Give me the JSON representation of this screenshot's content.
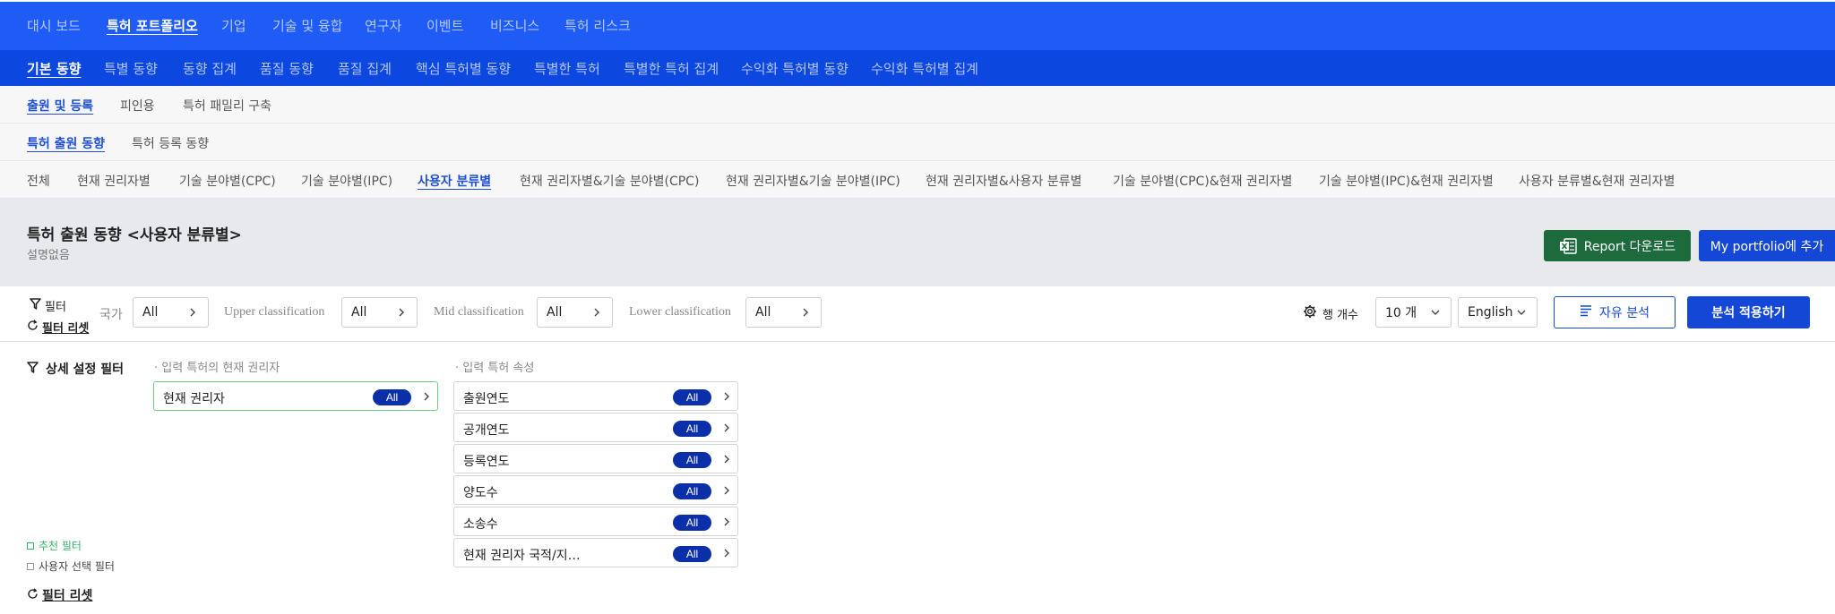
{
  "nav_main": {
    "items": [
      "대시 보드",
      "특허 포트폴리오",
      "기업",
      "기술 및 융합",
      "연구자",
      "이벤트",
      "비즈니스",
      "특허 리스크"
    ],
    "active": "특허 포트폴리오"
  },
  "nav_sub": {
    "items": [
      "기본 동향",
      "특별 동향",
      "동향 집계",
      "품질 동향",
      "품질 집계",
      "핵심 특허별 동향",
      "특별한 특허",
      "특별한 특허 집계",
      "수익화 특허별 동향",
      "수익화 특허별 집계"
    ],
    "active": "기본 동향"
  },
  "nav_level3": {
    "items": [
      "출원 및 등록",
      "피인용",
      "특허 패밀리 구축"
    ],
    "active": "출원 및 등록"
  },
  "nav_level4": {
    "items": [
      "특허 출원 동향",
      "특허 등록 동향"
    ],
    "active": "특허 출원 동향"
  },
  "nav_level5": {
    "items": [
      "전체",
      "현재 권리자별",
      "기술 분야별(CPC)",
      "기술 분야별(IPC)",
      "사용자 분류별",
      "현재 권리자별&기술 분야별(CPC)",
      "현재 권리자별&기술 분야별(IPC)",
      "현재 권리자별&사용자 분류별",
      "기술 분야별(CPC)&현재 권리자별",
      "기술 분야별(IPC)&현재 권리자별",
      "사용자 분류별&현재 권리자별"
    ],
    "active": "사용자 분류별"
  },
  "header": {
    "title": "특허 출원 동향 <사용자 분류별>",
    "description": "설명없음",
    "report_button": "Report 다운로드",
    "portfolio_button": "My portfolio에 추가"
  },
  "filter_bar": {
    "filter_label": "필터",
    "reset_label": "필터 리셋",
    "country_label": "국가",
    "country_value": "All",
    "upper_label": "Upper classification",
    "upper_value": "All",
    "mid_label": "Mid classification",
    "mid_value": "All",
    "lower_label": "Lower classification",
    "lower_value": "All",
    "rows_label": "행 개수",
    "rows_value": "10 개",
    "language_value": "English",
    "free_analysis_button": "자유 분석",
    "apply_button": "분석 적용하기"
  },
  "detail_filter": {
    "title": "상세 설정 필터",
    "owner_group_caption": "· 입력 특허의 현재 권리자",
    "owner_chip": {
      "label": "현재 권리자",
      "value": "All"
    },
    "attr_group_caption": "· 입력 특허 속성",
    "attributes": [
      {
        "label": "출원연도",
        "value": "All"
      },
      {
        "label": "공개연도",
        "value": "All"
      },
      {
        "label": "등록연도",
        "value": "All"
      },
      {
        "label": "양도수",
        "value": "All"
      },
      {
        "label": "소송수",
        "value": "All"
      },
      {
        "label": "현재 권리자 국적/지…",
        "value": "All"
      }
    ],
    "legend_recommended": "추천 필터",
    "legend_user": "사용자 선택 필터",
    "reset_label": "필터 리셋"
  },
  "colors": {
    "nav_main_bg": "#1f5cf5",
    "nav_sub_bg": "#0c47e0",
    "primary_button": "#1447d6",
    "excel_green": "#1d6b3c",
    "pill_navy": "#0b2fa8",
    "recommended_green": "#3bb36b"
  }
}
